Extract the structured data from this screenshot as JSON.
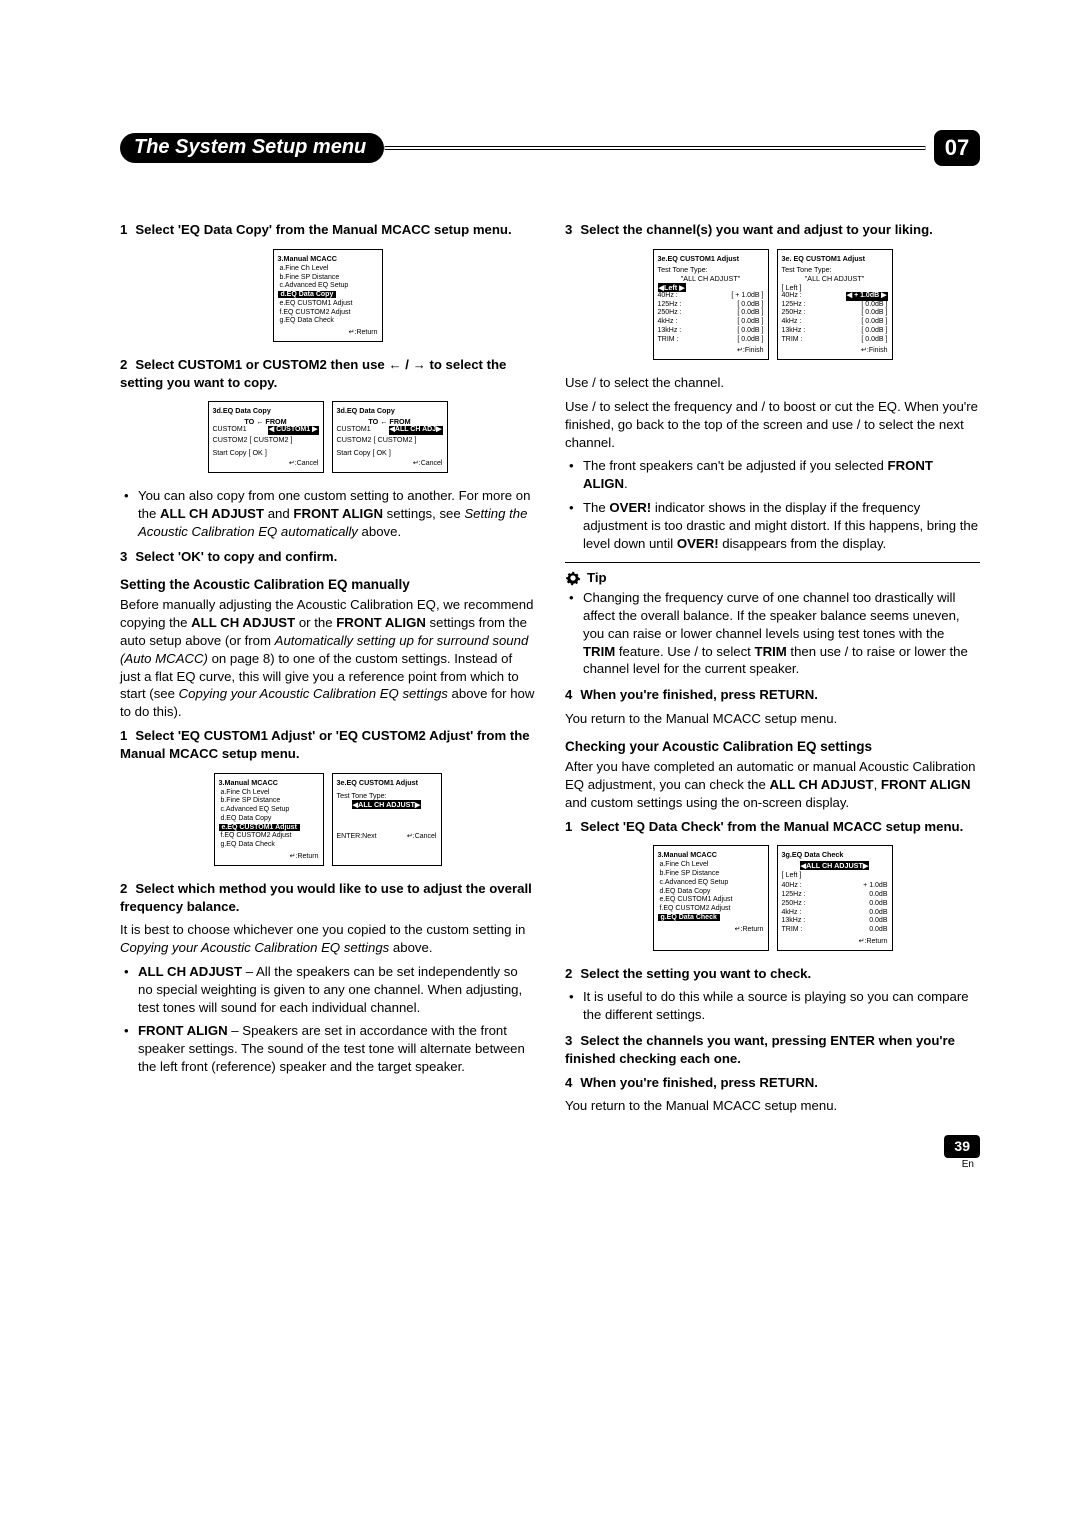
{
  "chapter": "07",
  "header_title": "The System Setup menu",
  "page_number": "39",
  "page_lang": "En",
  "left": {
    "step1": {
      "num": "1",
      "label": "Select 'EQ Data Copy' from the Manual MCACC setup menu."
    },
    "panel1": {
      "title": "3.Manual  MCACC",
      "items": [
        "a.Fine  Ch  Level",
        "b.Fine  SP  Distance",
        "c.Advanced EQ Setup",
        "d.EQ  Data  Copy",
        "e.EQ  CUSTOM1  Adjust",
        "f.EQ  CUSTOM2  Adjust",
        "g.EQ  Data  Check"
      ],
      "highlight": 3,
      "foot": "↵:Return"
    },
    "step2": {
      "num": "2",
      "label_a": "Select CUSTOM1 or CUSTOM2 then use ",
      "label_b": " / ",
      "label_c": " to select the setting you want to copy."
    },
    "panel2a": {
      "title": "3d.EQ  Data  Copy",
      "header": "TO    ←    FROM",
      "rows": [
        "CUSTOM1",
        "CUSTOM2   [    CUSTOM2    ]"
      ],
      "sel": "◀  CUSTOM1  ▶",
      "start": "Start Copy            [   OK   ]",
      "foot": "↵:Cancel"
    },
    "panel2b": {
      "title": "3d.EQ  Data  Copy",
      "header": "TO    ←    FROM",
      "rows": [
        "CUSTOM1",
        "CUSTOM2   [    CUSTOM2    ]"
      ],
      "sel": "◀ALL CH ADJ▶",
      "start": "Start Copy            [   OK   ]",
      "foot": "↵:Cancel"
    },
    "bullet1": "You can also copy from one custom setting to another. For more on the ",
    "bullet1b": "ALL CH ADJUST",
    "bullet1c": " and ",
    "bullet1d": "FRONT ALIGN",
    "bullet1e": " settings, see ",
    "bullet1f": "Setting the Acoustic Calibration EQ automatically",
    "bullet1g": " above.",
    "step3": {
      "num": "3",
      "label": "Select 'OK' to copy and confirm."
    },
    "h_manual": "Setting the Acoustic Calibration EQ manually",
    "man_p1": "Before manually adjusting the Acoustic Calibration EQ, we recommend copying the ",
    "man_p1b": "ALL CH ADJUST",
    "man_p1c": " or the ",
    "man_p1d": "FRONT ALIGN",
    "man_p1e": " settings from the auto setup above (or from ",
    "man_p1f": "Automatically setting up for surround sound (Auto MCACC)",
    "man_p1g": " on page 8) to one of the custom settings. Instead of just a flat EQ curve, this will give you a reference point from which to start (see ",
    "man_p1h": "Copying your Acoustic Calibration EQ settings",
    "man_p1i": " above for how to do this).",
    "mstep1": {
      "num": "1",
      "label": "Select 'EQ CUSTOM1 Adjust' or 'EQ CUSTOM2 Adjust' from the Manual MCACC setup menu."
    },
    "panel3a": {
      "title": "3.Manual  MCACC",
      "items": [
        "a.Fine  Ch  Level",
        "b.Fine  SP  Distance",
        "c.Advanced EQ Setup",
        "d.EQ  Data  Copy",
        "e.EQ  CUSTOM1  Adjust",
        "f.EQ  CUSTOM2  Adjust",
        "g.EQ  Data  Check"
      ],
      "highlight": 4,
      "foot": "↵:Return"
    },
    "panel3b": {
      "title": "3e.EQ  CUSTOM1  Adjust",
      "line1": "Test Tone Type:",
      "sel": "◀ALL  CH  ADJUST▶",
      "foot_l": "ENTER:Next",
      "foot_r": "↵:Cancel"
    },
    "mstep2": {
      "num": "2",
      "label": "Select which method you would like to use to adjust the overall frequency balance."
    },
    "mstep2_p": "It is best to choose whichever one you copied to the custom setting in ",
    "mstep2_pi": "Copying your Acoustic Calibration EQ settings",
    "mstep2_pe": " above.",
    "b_all": "ALL CH ADJUST",
    "b_all_t": " – All the speakers can be set independently so no special weighting is given to any one channel. When adjusting, test tones will sound for each individual channel.",
    "b_fa": "FRONT ALIGN",
    "b_fa_t": " – Speakers are set in accordance with the front speaker settings. The sound of the test tone will alternate between the left front (reference) speaker and the target speaker."
  },
  "right": {
    "step3": {
      "num": "3",
      "label": "Select the channel(s) you want and adjust to your liking."
    },
    "panel4a": {
      "title": "3e.EQ  CUSTOM1  Adjust",
      "l1": "Test Tone Type:",
      "l2": "\"ALL  CH  ADJUST\"",
      "sel": "◀Left              ▶",
      "rows": [
        {
          "k": "40Hz :",
          "v": "[ +   1.0dB ]"
        },
        {
          "k": "125Hz :",
          "v": "[      0.0dB ]"
        },
        {
          "k": "250Hz :",
          "v": "[      0.0dB ]"
        },
        {
          "k": "4kHz :",
          "v": "[      0.0dB ]"
        },
        {
          "k": "13kHz :",
          "v": "[      0.0dB ]"
        },
        {
          "k": "TRIM :",
          "v": "[      0.0dB ]"
        }
      ],
      "foot": "↵:Finish"
    },
    "panel4b": {
      "title": "3e. EQ  CUSTOM1  Adjust",
      "l1": "Test Tone Type:",
      "l2": "\"ALL  CH  ADJUST\"",
      "sel_plain": "[ Left              ]",
      "rows": [
        {
          "k": "40Hz :",
          "v": "◀ +   1.0dB ▶",
          "hl": true
        },
        {
          "k": "125Hz :",
          "v": "[      0.0dB ]"
        },
        {
          "k": "250Hz :",
          "v": "[      0.0dB ]"
        },
        {
          "k": "4kHz :",
          "v": "[      0.0dB ]"
        },
        {
          "k": "13kHz :",
          "v": "[      0.0dB ]"
        },
        {
          "k": "TRIM :",
          "v": "[      0.0dB ]"
        }
      ],
      "foot": "↵:Finish"
    },
    "use1": "Use    /    to select the channel.",
    "use2": "Use    /    to select the frequency and    /    to boost or cut the EQ. When you're finished, go back to the top of the screen and use    /    to select the next channel.",
    "rb1a": "The front speakers can't be adjusted if you selected ",
    "rb1b": "FRONT ALIGN",
    "rb1c": ".",
    "rb2a": "The ",
    "rb2b": "OVER!",
    "rb2c": " indicator shows in the display if the frequency adjustment is too drastic and might distort. If this happens, bring the level down until ",
    "rb2d": "OVER!",
    "rb2e": " disappears from the display.",
    "tip_label": "Tip",
    "tip_p": "Changing the frequency curve of one channel too drastically will affect the overall balance. If the speaker balance seems uneven, you can raise or lower channel levels using test tones with the ",
    "tip_b": "TRIM",
    "tip_p2": " feature. Use    /    to select ",
    "tip_b2": "TRIM",
    "tip_p3": " then use    /    to raise or lower the channel level for the current speaker.",
    "rstep4": {
      "num": "4",
      "label": "When you're finished, press RETURN."
    },
    "rstep4_p": "You return to the Manual MCACC setup menu.",
    "h_check": "Checking your Acoustic Calibration EQ settings",
    "check_p": "After you have completed an automatic or manual Acoustic Calibration EQ adjustment, you can check the ",
    "check_b1": "ALL CH ADJUST",
    "check_c1": ", ",
    "check_b2": "FRONT ALIGN",
    "check_c2": " and custom settings using the on-screen display.",
    "cstep1": {
      "num": "1",
      "label": "Select 'EQ Data Check' from the Manual MCACC setup menu."
    },
    "panel5a": {
      "title": "3.Manual  MCACC",
      "items": [
        "a.Fine  Ch  Level",
        "b.Fine  SP  Distance",
        "c.Advanced EQ Setup",
        "d.EQ  Data  Copy",
        "e.EQ  CUSTOM1  Adjust",
        "f.EQ  CUSTOM2  Adjust",
        "g.EQ  Data  Check"
      ],
      "highlight": 6,
      "foot": "↵:Return"
    },
    "panel5b": {
      "title": "3g.EQ  Data  Check",
      "sel": "◀ALL  CH  ADJUST▶",
      "sel2": "[ Left                ]",
      "rows": [
        {
          "k": "40Hz :",
          "v": "+   1.0dB"
        },
        {
          "k": "125Hz :",
          "v": "0.0dB"
        },
        {
          "k": "250Hz :",
          "v": "0.0dB"
        },
        {
          "k": "4kHz :",
          "v": "0.0dB"
        },
        {
          "k": "13kHz :",
          "v": "0.0dB"
        },
        {
          "k": "TRIM :",
          "v": "0.0dB"
        }
      ],
      "foot": "↵:Return"
    },
    "cstep2": {
      "num": "2",
      "label": "Select the setting you want to check."
    },
    "cstep2_b": "It is useful to do this while a source is playing so you can compare the different settings.",
    "cstep3": {
      "num": "3",
      "label": "Select the channels you want, pressing ENTER when you're finished checking each one."
    },
    "cstep4": {
      "num": "4",
      "label": "When you're finished, press RETURN."
    },
    "cstep4_p": "You return to the Manual MCACC setup menu."
  }
}
